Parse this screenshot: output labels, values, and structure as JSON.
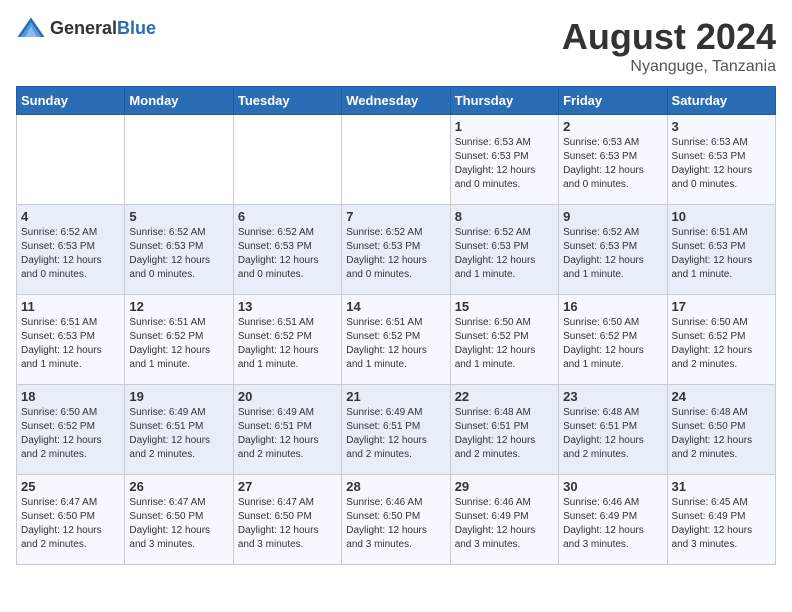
{
  "header": {
    "logo_general": "General",
    "logo_blue": "Blue",
    "title": "August 2024",
    "subtitle": "Nyanguge, Tanzania"
  },
  "days_of_week": [
    "Sunday",
    "Monday",
    "Tuesday",
    "Wednesday",
    "Thursday",
    "Friday",
    "Saturday"
  ],
  "weeks": [
    [
      {
        "day": "",
        "info": ""
      },
      {
        "day": "",
        "info": ""
      },
      {
        "day": "",
        "info": ""
      },
      {
        "day": "",
        "info": ""
      },
      {
        "day": "1",
        "info": "Sunrise: 6:53 AM\nSunset: 6:53 PM\nDaylight: 12 hours\nand 0 minutes."
      },
      {
        "day": "2",
        "info": "Sunrise: 6:53 AM\nSunset: 6:53 PM\nDaylight: 12 hours\nand 0 minutes."
      },
      {
        "day": "3",
        "info": "Sunrise: 6:53 AM\nSunset: 6:53 PM\nDaylight: 12 hours\nand 0 minutes."
      }
    ],
    [
      {
        "day": "4",
        "info": "Sunrise: 6:52 AM\nSunset: 6:53 PM\nDaylight: 12 hours\nand 0 minutes."
      },
      {
        "day": "5",
        "info": "Sunrise: 6:52 AM\nSunset: 6:53 PM\nDaylight: 12 hours\nand 0 minutes."
      },
      {
        "day": "6",
        "info": "Sunrise: 6:52 AM\nSunset: 6:53 PM\nDaylight: 12 hours\nand 0 minutes."
      },
      {
        "day": "7",
        "info": "Sunrise: 6:52 AM\nSunset: 6:53 PM\nDaylight: 12 hours\nand 0 minutes."
      },
      {
        "day": "8",
        "info": "Sunrise: 6:52 AM\nSunset: 6:53 PM\nDaylight: 12 hours\nand 1 minute."
      },
      {
        "day": "9",
        "info": "Sunrise: 6:52 AM\nSunset: 6:53 PM\nDaylight: 12 hours\nand 1 minute."
      },
      {
        "day": "10",
        "info": "Sunrise: 6:51 AM\nSunset: 6:53 PM\nDaylight: 12 hours\nand 1 minute."
      }
    ],
    [
      {
        "day": "11",
        "info": "Sunrise: 6:51 AM\nSunset: 6:53 PM\nDaylight: 12 hours\nand 1 minute."
      },
      {
        "day": "12",
        "info": "Sunrise: 6:51 AM\nSunset: 6:52 PM\nDaylight: 12 hours\nand 1 minute."
      },
      {
        "day": "13",
        "info": "Sunrise: 6:51 AM\nSunset: 6:52 PM\nDaylight: 12 hours\nand 1 minute."
      },
      {
        "day": "14",
        "info": "Sunrise: 6:51 AM\nSunset: 6:52 PM\nDaylight: 12 hours\nand 1 minute."
      },
      {
        "day": "15",
        "info": "Sunrise: 6:50 AM\nSunset: 6:52 PM\nDaylight: 12 hours\nand 1 minute."
      },
      {
        "day": "16",
        "info": "Sunrise: 6:50 AM\nSunset: 6:52 PM\nDaylight: 12 hours\nand 1 minute."
      },
      {
        "day": "17",
        "info": "Sunrise: 6:50 AM\nSunset: 6:52 PM\nDaylight: 12 hours\nand 2 minutes."
      }
    ],
    [
      {
        "day": "18",
        "info": "Sunrise: 6:50 AM\nSunset: 6:52 PM\nDaylight: 12 hours\nand 2 minutes."
      },
      {
        "day": "19",
        "info": "Sunrise: 6:49 AM\nSunset: 6:51 PM\nDaylight: 12 hours\nand 2 minutes."
      },
      {
        "day": "20",
        "info": "Sunrise: 6:49 AM\nSunset: 6:51 PM\nDaylight: 12 hours\nand 2 minutes."
      },
      {
        "day": "21",
        "info": "Sunrise: 6:49 AM\nSunset: 6:51 PM\nDaylight: 12 hours\nand 2 minutes."
      },
      {
        "day": "22",
        "info": "Sunrise: 6:48 AM\nSunset: 6:51 PM\nDaylight: 12 hours\nand 2 minutes."
      },
      {
        "day": "23",
        "info": "Sunrise: 6:48 AM\nSunset: 6:51 PM\nDaylight: 12 hours\nand 2 minutes."
      },
      {
        "day": "24",
        "info": "Sunrise: 6:48 AM\nSunset: 6:50 PM\nDaylight: 12 hours\nand 2 minutes."
      }
    ],
    [
      {
        "day": "25",
        "info": "Sunrise: 6:47 AM\nSunset: 6:50 PM\nDaylight: 12 hours\nand 2 minutes."
      },
      {
        "day": "26",
        "info": "Sunrise: 6:47 AM\nSunset: 6:50 PM\nDaylight: 12 hours\nand 3 minutes."
      },
      {
        "day": "27",
        "info": "Sunrise: 6:47 AM\nSunset: 6:50 PM\nDaylight: 12 hours\nand 3 minutes."
      },
      {
        "day": "28",
        "info": "Sunrise: 6:46 AM\nSunset: 6:50 PM\nDaylight: 12 hours\nand 3 minutes."
      },
      {
        "day": "29",
        "info": "Sunrise: 6:46 AM\nSunset: 6:49 PM\nDaylight: 12 hours\nand 3 minutes."
      },
      {
        "day": "30",
        "info": "Sunrise: 6:46 AM\nSunset: 6:49 PM\nDaylight: 12 hours\nand 3 minutes."
      },
      {
        "day": "31",
        "info": "Sunrise: 6:45 AM\nSunset: 6:49 PM\nDaylight: 12 hours\nand 3 minutes."
      }
    ]
  ]
}
